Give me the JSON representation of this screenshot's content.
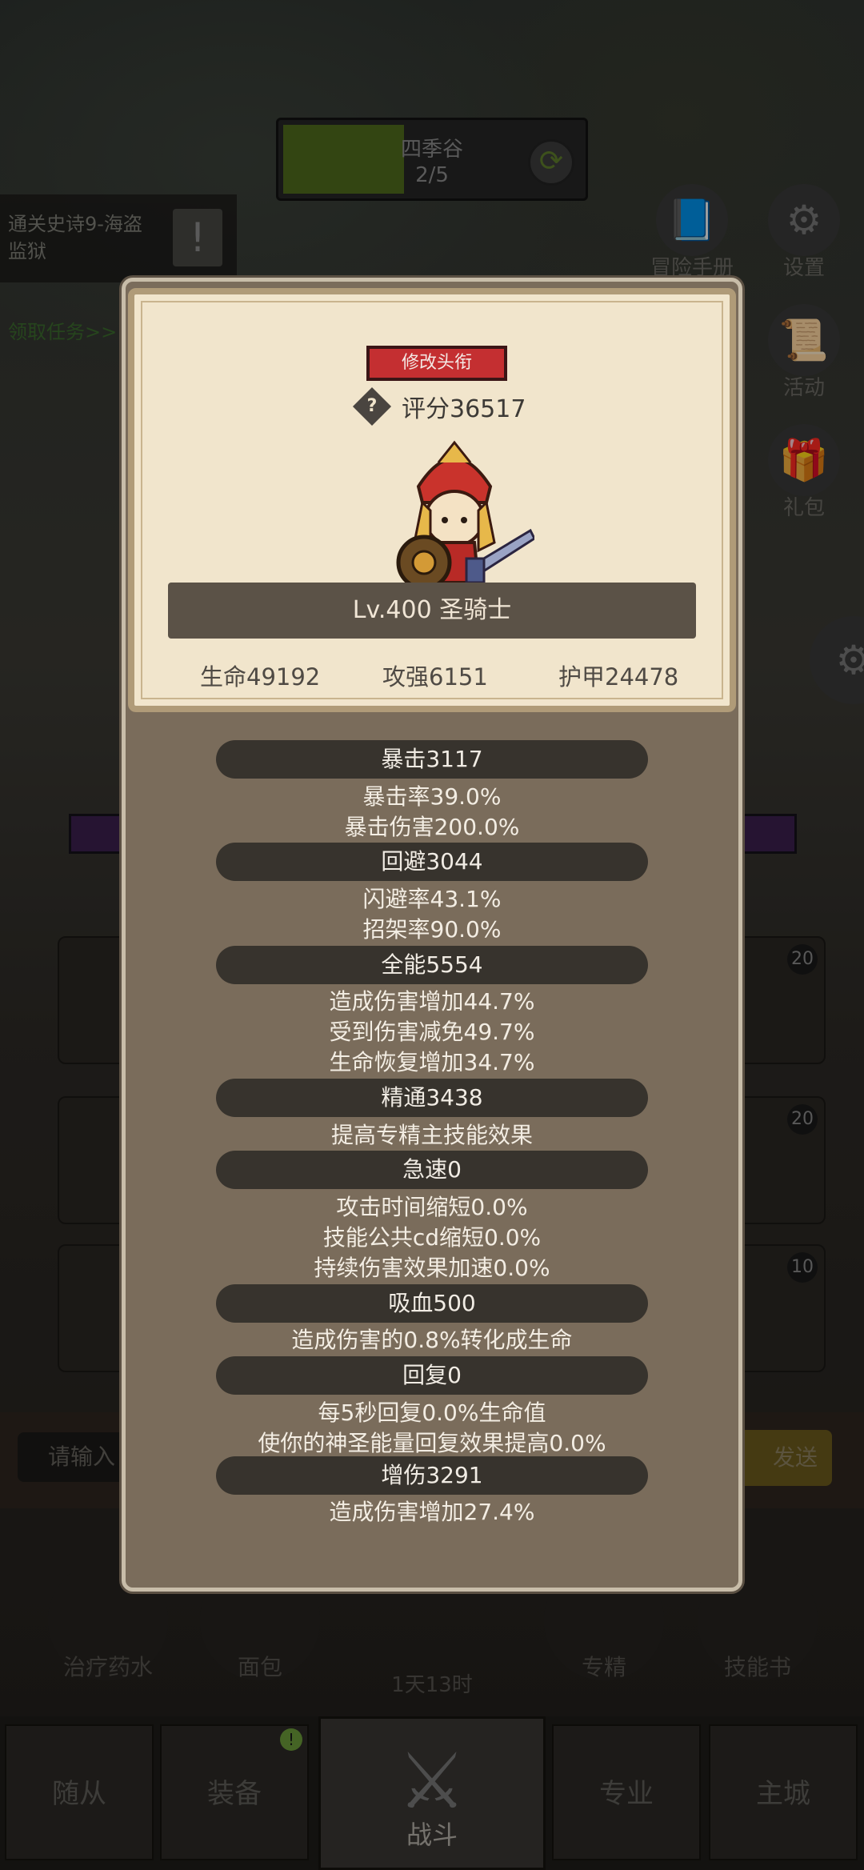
{
  "zone": {
    "name": "四季谷",
    "progress": "2/5",
    "progress_value": 0.4
  },
  "quest": {
    "title": "通关史诗9-海盗监狱",
    "link": "领取任务>>"
  },
  "side_buttons": [
    {
      "label": "冒险手册",
      "icon": "book-icon"
    },
    {
      "label": "设置",
      "icon": "gear-icon"
    },
    {
      "label": "活动",
      "icon": "scroll-icon"
    },
    {
      "label": "礼包",
      "icon": "gift-icon"
    }
  ],
  "card": {
    "edit_title_button": "修改头衔",
    "score": "评分36517",
    "level_class": "Lv.400 圣骑士",
    "hp": "生命49192",
    "attack": "攻强6151",
    "armor": "护甲24478"
  },
  "stats": [
    {
      "header": "暴击3117",
      "lines": [
        "暴击率39.0%",
        "暴击伤害200.0%"
      ]
    },
    {
      "header": "回避3044",
      "lines": [
        "闪避率43.1%",
        "招架率90.0%"
      ]
    },
    {
      "header": "全能5554",
      "lines": [
        "造成伤害增加44.7%",
        "受到伤害减免49.7%",
        "生命恢复增加34.7%"
      ]
    },
    {
      "header": "精通3438",
      "lines": [
        "提高专精主技能效果"
      ]
    },
    {
      "header": "急速0",
      "lines": [
        "攻击时间缩短0.0%",
        "技能公共cd缩短0.0%",
        "持续伤害效果加速0.0%"
      ]
    },
    {
      "header": "吸血500",
      "lines": [
        "造成伤害的0.8%转化成生命"
      ]
    },
    {
      "header": "回复0",
      "lines": [
        "每5秒回复0.0%生命值",
        "使你的神圣能量回复效果提高0.0%"
      ]
    },
    {
      "header": "增伤3291",
      "lines": [
        "造成伤害增加27.4%"
      ]
    }
  ],
  "chat": {
    "placeholder": "请输入",
    "send": "发送"
  },
  "slots": {
    "r1": "20",
    "r2": "20",
    "r3": "10"
  },
  "skills": {
    "potion": "治疗药水",
    "bread": "面包",
    "spec": "专精",
    "book": "技能书",
    "timer": "1天13时"
  },
  "nav": {
    "follower": "随从",
    "equipment": "装备",
    "battle": "战斗",
    "profession": "专业",
    "city": "主城",
    "badge": "!"
  }
}
